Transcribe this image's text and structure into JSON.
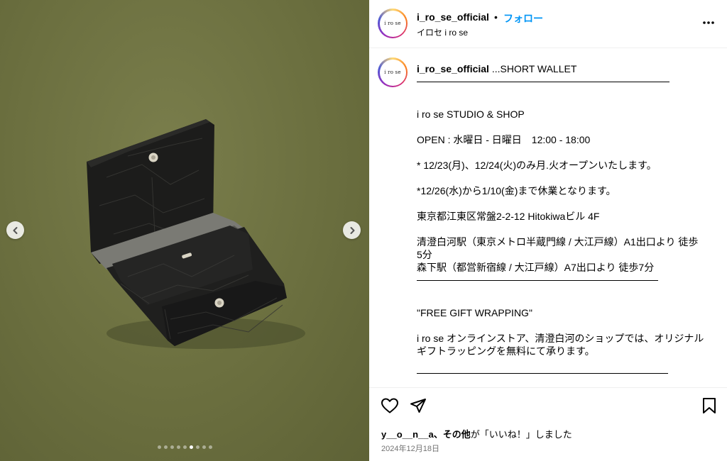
{
  "post": {
    "username": "i_ro_se_official",
    "bullet": "•",
    "follow_label": "フォロー",
    "display_name": "イロセ i ro se",
    "avatar_text": "i ro se"
  },
  "media": {
    "image_subject": "black leather short wallet on olive green background",
    "slide_count": 9,
    "active_slide": 6,
    "prev_icon": "chevron-left-icon",
    "next_icon": "chevron-right-icon",
    "background_color": "#6f7343"
  },
  "caption": {
    "username": "i_ro_se_official",
    "first_line": " ...SHORT WALLET",
    "rule_glyph": "________________________________",
    "studio": "i ro se STUDIO & SHOP",
    "open_hours": "OPEN : 水曜日 - 日曜日　12:00 - 18:00",
    "note_1": "* 12/23(月)、12/24(火)のみ月.火オープンいたします。",
    "note_2": "*12/26(水)から1/10(金)まで休業となります。",
    "address": "東京都江東区常盤2-2-12 Hitokiwaビル 4F",
    "access_1a": "清澄白河駅（東京メトロ半蔵門線 / 大江戸線）A1出口より 徒歩",
    "access_1b": "5分",
    "access_2": "森下駅（都営新宿線 / 大江戸線）A7出口より 徒歩7分",
    "gift_title": "\"FREE GIFT WRAPPING\"",
    "gift_body_1": "i ro se オンラインストア、清澄白河のショップでは、オリジナル",
    "gift_body_2": "ギフトラッピングを無料にて承ります。"
  },
  "actions": {
    "like_icon": "heart-icon",
    "share_icon": "paper-plane-icon",
    "save_icon": "bookmark-icon",
    "likes_user": "y__o__n__a",
    "likes_others": "、その他",
    "likes_suffix": "が「いいね！」しました",
    "date": "2024年12月18日"
  },
  "colors": {
    "accent": "#0095f6",
    "divider": "#efefef",
    "muted": "#737373"
  }
}
